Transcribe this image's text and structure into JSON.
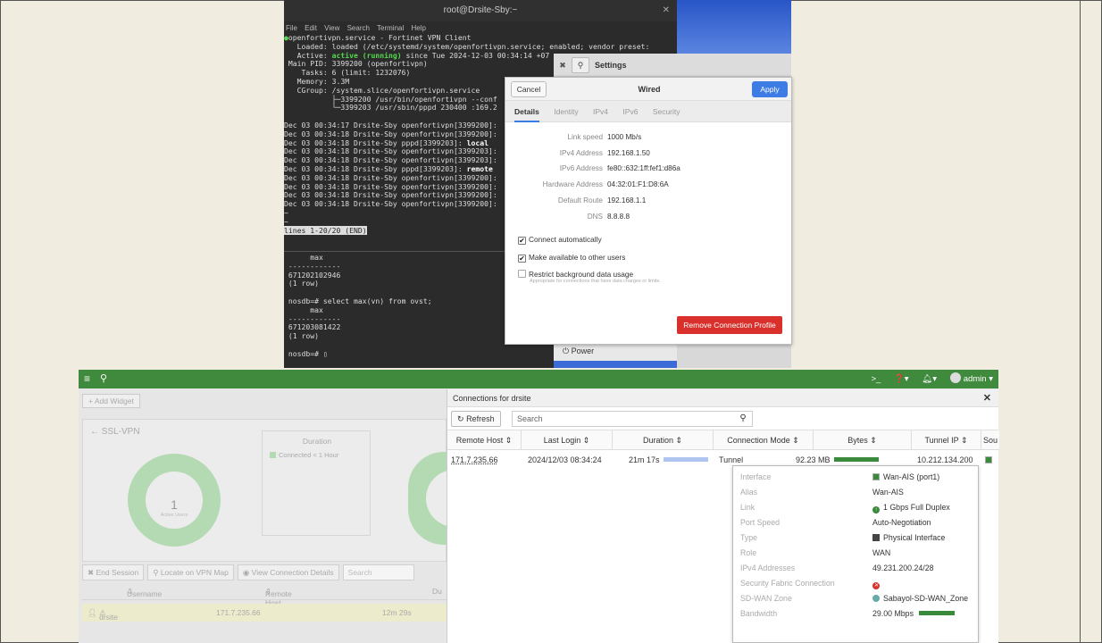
{
  "terminal": {
    "title": "root@Drsite-Sby:~",
    "menu": [
      "File",
      "Edit",
      "View",
      "Search",
      "Terminal",
      "Help"
    ],
    "service_lines": [
      "openfortivpn.service - Fortinet VPN Client",
      "   Loaded: loaded (/etc/systemd/system/openfortivpn.service; enabled; vendor preset:",
      "   Active: active (running) since Tue 2024-12-03 00:34:14 +07",
      " Main PID: 3399200 (openfortivpn)",
      "    Tasks: 6 (limit: 1232076)",
      "   Memory: 3.3M",
      "   CGroup: /system.slice/openfortivpn.service",
      "           ├─3399200 /usr/bin/openfortivpn --conf",
      "           └─3399203 /usr/sbin/pppd 230400 :169.2"
    ],
    "log_lines": [
      "Dec 03 00:34:17 Drsite-Sby openfortivpn[3399200]:",
      "Dec 03 00:34:18 Drsite-Sby openfortivpn[3399200]:",
      "Dec 03 00:34:18 Drsite-Sby pppd[3399203]: local",
      "Dec 03 00:34:18 Drsite-Sby openfortivpn[3399203]:",
      "Dec 03 00:34:18 Drsite-Sby openfortivpn[3399203]:",
      "Dec 03 00:34:18 Drsite-Sby pppd[3399203]: remote",
      "Dec 03 00:34:18 Drsite-Sby openfortivpn[3399200]:",
      "Dec 03 00:34:18 Drsite-Sby openfortivpn[3399200]:",
      "Dec 03 00:34:18 Drsite-Sby openfortivpn[3399200]:",
      "Dec 03 00:34:18 Drsite-Sby openfortivpn[3399200]:"
    ],
    "pager": "lines 1-20/20 (END)",
    "sql_lines": [
      "      max",
      " ------------",
      " 671202102946",
      " (1 row)",
      "",
      " nosdb=# select max(vn) from ovst;",
      "      max",
      " ------------",
      " 671203081422",
      " (1 row)",
      "",
      " nosdb=# "
    ]
  },
  "settings": {
    "title": "Settings",
    "power_label": "Power"
  },
  "wired_dialog": {
    "cancel": "Cancel",
    "title": "Wired",
    "apply": "Apply",
    "tabs": [
      "Details",
      "Identity",
      "IPv4",
      "IPv6",
      "Security"
    ],
    "details": [
      {
        "label": "Link speed",
        "value": "1000 Mb/s"
      },
      {
        "label": "IPv4 Address",
        "value": "192.168.1.50"
      },
      {
        "label": "IPv6 Address",
        "value": "fe80::632:1ff:fef1:d86a"
      },
      {
        "label": "Hardware Address",
        "value": "04:32:01:F1:D8:6A"
      },
      {
        "label": "Default Route",
        "value": "192.168.1.1"
      },
      {
        "label": "DNS",
        "value": "8.8.8.8"
      }
    ],
    "connect_auto": "Connect automatically",
    "available_others": "Make available to other users",
    "restrict_bg": "Restrict background data usage",
    "restrict_hint": "Appropriate for connections that have data charges or limits.",
    "remove": "Remove Connection Profile"
  },
  "fortigate": {
    "user": "admin",
    "add_widget": "+ Add Widget",
    "panel_title": "SSL-VPN",
    "donut_count": "1",
    "donut_label": "Active Users",
    "duration_title": "Duration",
    "duration_legend": "Connected < 1 Hour",
    "buttons": [
      "End Session",
      "Locate on VPN Map",
      "View Connection Details"
    ],
    "search": "Search",
    "headers": [
      "Username",
      "Remote Host",
      "Du"
    ],
    "row": {
      "user": "drsite",
      "host": "171.7.235.66",
      "duration": "12m 29s"
    }
  },
  "connections": {
    "title": "Connections for drsite",
    "refresh": "Refresh",
    "search_placeholder": "Search",
    "columns": [
      "Remote Host",
      "Last Login",
      "Duration",
      "Connection Mode",
      "Bytes",
      "Tunnel IP",
      "Sou"
    ],
    "row": {
      "remote_host": "171.7.235.66",
      "last_login": "2024/12/03 08:34:24",
      "duration": "21m 17s",
      "mode": "Tunnel",
      "bytes": "92.23 MB",
      "tunnel_ip": "10.212.134.200"
    }
  },
  "interface_tooltip": {
    "rows": [
      {
        "key": "Interface",
        "value": "Wan-AIS (port1)"
      },
      {
        "key": "Alias",
        "value": "Wan-AIS"
      },
      {
        "key": "Link",
        "value": "1 Gbps Full Duplex"
      },
      {
        "key": "Port Speed",
        "value": "Auto-Negotiation"
      },
      {
        "key": "Type",
        "value": "Physical Interface"
      },
      {
        "key": "Role",
        "value": "WAN"
      },
      {
        "key": "IPv4 Addresses",
        "value": "49.231.200.24/28"
      },
      {
        "key": "Security Fabric Connection",
        "value": ""
      },
      {
        "key": "SD-WAN Zone",
        "value": "Sabayol-SD-WAN_Zone"
      },
      {
        "key": "Bandwidth",
        "value": "29.00 Mbps"
      }
    ]
  }
}
